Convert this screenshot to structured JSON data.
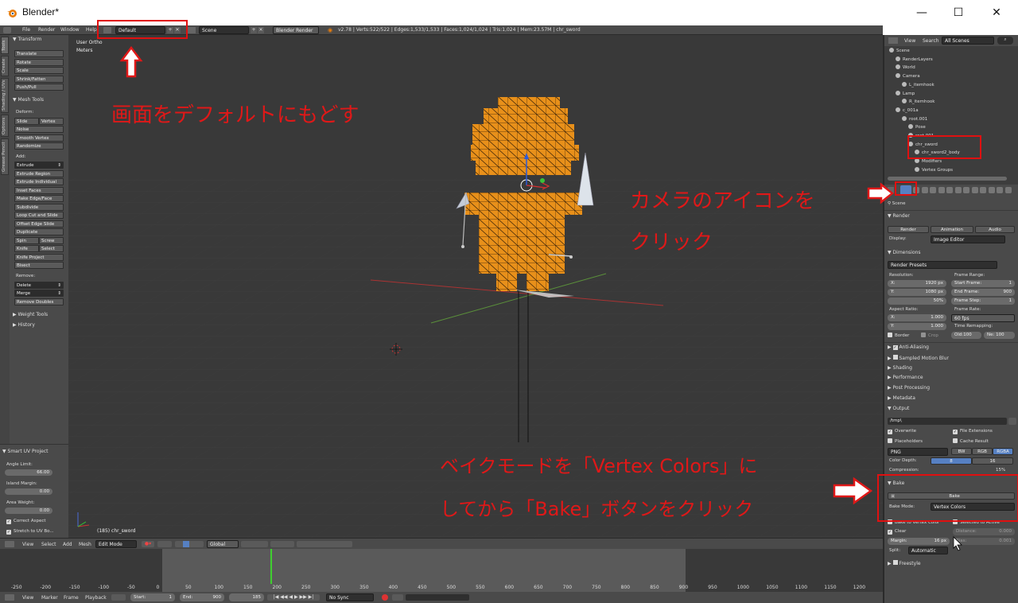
{
  "window": {
    "title": "Blender*",
    "minimize": "—",
    "maximize": "☐",
    "close": "✕"
  },
  "topbar": {
    "menus": [
      "File",
      "Render",
      "Window",
      "Help"
    ],
    "layout": "Default",
    "scene": "Scene",
    "engine": "Blender Render",
    "stats": "v2.78 | Verts:522/522 | Edges:1,533/1,533 | Faces:1,024/1,024 | Tris:1,024 | Mem:23.57M | chr_sword"
  },
  "toolshelf": {
    "tabs": [
      "Tools",
      "Create",
      "Shading / UVs",
      "Options",
      "Grease Pencil"
    ],
    "transform": {
      "header": "Transform",
      "buttons": [
        "Translate",
        "Rotate",
        "Scale",
        "Shrink/Fatten",
        "Push/Pull"
      ]
    },
    "mesh_tools": {
      "header": "Mesh Tools",
      "deform_label": "Deform:",
      "slide_edge": "Slide Edge",
      "vertex": "Vertex",
      "noise": "Noise",
      "smooth_vertex": "Smooth Vertex",
      "randomize": "Randomize",
      "add_label": "Add:",
      "extrude": "Extrude",
      "add_buttons": [
        "Extrude Region",
        "Extrude Individual",
        "Inset Faces",
        "Make Edge/Face",
        "Subdivide",
        "Loop Cut and Slide",
        "Offset Edge Slide",
        "Duplicate"
      ],
      "spin": "Spin",
      "screw": "Screw",
      "knife": "Knife",
      "select": "Select",
      "knife_project": "Knife Project",
      "bisect": "Bisect",
      "remove_label": "Remove:",
      "delete": "Delete",
      "merge": "Merge",
      "remove_doubles": "Remove Doubles"
    },
    "weight_tools": "Weight Tools",
    "history": "History",
    "smart_uv": {
      "header": "Smart UV Project",
      "angle_limit_label": "Angle Limit:",
      "angle_limit": "66.00",
      "island_margin_label": "Island Margin:",
      "island_margin": "0.00",
      "area_weight_label": "Area Weight:",
      "area_weight": "0.00",
      "correct_aspect": "Correct Aspect",
      "stretch": "Stretch to UV Bo..."
    }
  },
  "viewport": {
    "view_label": "User Ortho",
    "units": "Meters",
    "object_info": "(185) chr_sword"
  },
  "viewport_header": {
    "view": "View",
    "select": "Select",
    "add": "Add",
    "mesh": "Mesh",
    "mode": "Edit Mode",
    "orientation": "Global"
  },
  "timeline": {
    "ticks": [
      "-250",
      "-200",
      "-150",
      "-100",
      "-50",
      "0",
      "50",
      "100",
      "150",
      "200",
      "250",
      "300",
      "350",
      "400",
      "450",
      "500",
      "550",
      "600",
      "650",
      "700",
      "750",
      "800",
      "850",
      "900",
      "950",
      "1000",
      "1050",
      "1100",
      "1150",
      "1200"
    ],
    "current_frame": 185,
    "range_start": 0,
    "range_end": 900,
    "view_min": -280,
    "view_max": 1240
  },
  "timeline_header": {
    "view": "View",
    "marker": "Marker",
    "frame": "Frame",
    "playback": "Playback",
    "start_label": "Start:",
    "start": "1",
    "end_label": "End:",
    "end": "900",
    "current": "185",
    "sync": "No Sync"
  },
  "outliner": {
    "view": "View",
    "search": "Search",
    "scenes": "All Scenes",
    "items": [
      {
        "label": "Scene",
        "indent": 0
      },
      {
        "label": "RenderLayers",
        "indent": 1
      },
      {
        "label": "World",
        "indent": 1
      },
      {
        "label": "Camera",
        "indent": 1
      },
      {
        "label": "L_itemhook",
        "indent": 2
      },
      {
        "label": "Lamp",
        "indent": 1
      },
      {
        "label": "R_itemhook",
        "indent": 2
      },
      {
        "label": "c_001a",
        "indent": 1
      },
      {
        "label": "root.001",
        "indent": 2
      },
      {
        "label": "Pose",
        "indent": 3
      },
      {
        "label": "root.001",
        "indent": 3
      },
      {
        "label": "chr_sword",
        "indent": 3
      },
      {
        "label": "chr_sword2_body",
        "indent": 4
      },
      {
        "label": "Modifiers",
        "indent": 4
      },
      {
        "label": "Vertex Groups",
        "indent": 4
      }
    ]
  },
  "properties": {
    "scene": "Scene",
    "render": {
      "header": "Render",
      "render_btn": "Render",
      "animation_btn": "Animation",
      "audio_btn": "Audio",
      "display_label": "Display:",
      "display": "Image Editor"
    },
    "dimensions": {
      "header": "Dimensions",
      "presets": "Render Presets",
      "resolution_label": "Resolution:",
      "res_x": "X:",
      "res_x_val": "1920 px",
      "res_y": "Y:",
      "res_y_val": "1080 px",
      "res_pct": "50%",
      "frame_range_label": "Frame Range:",
      "start_frame": "Start Frame:",
      "start_frame_val": "1",
      "end_frame": "End Frame:",
      "end_frame_val": "900",
      "frame_step": "Frame Step:",
      "frame_step_val": "1",
      "aspect_label": "Aspect Ratio:",
      "asp_x": "X:",
      "asp_x_val": "1.000",
      "asp_y": "Y:",
      "asp_y_val": "1.000",
      "frame_rate_label": "Frame Rate:",
      "frame_rate": "60 fps",
      "time_remap_label": "Time Remapping:",
      "old": "Old:100",
      "new": "Ne: 100",
      "border": "Border",
      "crop": "Crop"
    },
    "collapsed": [
      "Anti-Aliasing",
      "Sampled Motion Blur",
      "Shading",
      "Performance",
      "Post Processing",
      "Metadata"
    ],
    "output": {
      "header": "Output",
      "path": "/tmp\\",
      "overwrite": "Overwrite",
      "file_ext": "File Extensions",
      "placeholders": "Placeholders",
      "cache_result": "Cache Result",
      "format": "PNG",
      "bw": "BW",
      "rgb": "RGB",
      "rgba": "RGBA",
      "color_depth_label": "Color Depth:",
      "depth_8": "8",
      "depth_16": "16",
      "compression_label": "Compression:",
      "compression": "15%"
    },
    "bake": {
      "header": "Bake",
      "bake_btn": "Bake",
      "bake_mode_label": "Bake Mode:",
      "bake_mode": "Vertex Colors",
      "bake_to_vc": "Bake to Vertex Color",
      "selected_to_active": "Selected to Active",
      "clear": "Clear",
      "distance_label": "Distance:",
      "distance": "0.000",
      "margin_label": "Margin:",
      "margin": "16 px",
      "bias_label": "Bias:",
      "bias": "0.001",
      "split_label": "Split:",
      "split": "Automatic"
    },
    "freestyle": "Freestyle"
  },
  "annotations": {
    "default": "画面をデフォルトにもどす",
    "camera1": "カメラのアイコンを",
    "camera2": "クリック",
    "bake1": "ベイクモードを「Vertex Colors」に",
    "bake2": "してから「Bake」ボタンをクリック"
  },
  "colors": {
    "accent_red": "#e01818",
    "mesh_orange": "#e8901a",
    "selected_blue": "#5680c2",
    "timeline_current": "#3fcf2f"
  }
}
